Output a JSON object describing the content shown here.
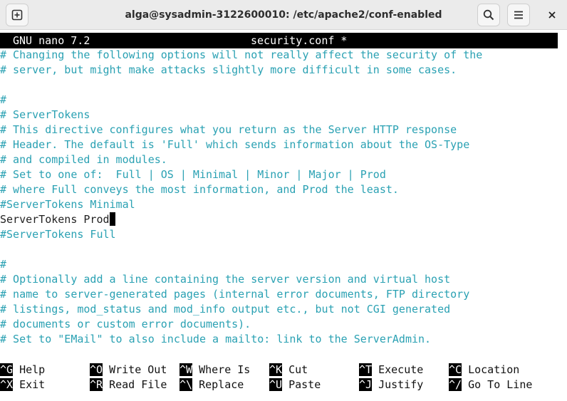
{
  "window": {
    "title": "alga@sysadmin-3122600010: /etc/apache2/conf-enabled"
  },
  "titlebar_icons": {
    "new_tab": "new-tab-icon",
    "search": "search-icon",
    "menu": "hamburger-menu-icon",
    "close": "close-icon"
  },
  "nano": {
    "version": "GNU nano 7.2",
    "filename": "security.conf *"
  },
  "file_lines": [
    "# Changing the following options will not really affect the security of the",
    "# server, but might make attacks slightly more difficult in some cases.",
    "",
    "#",
    "# ServerTokens",
    "# This directive configures what you return as the Server HTTP response",
    "# Header. The default is 'Full' which sends information about the OS-Type",
    "# and compiled in modules.",
    "# Set to one of:  Full | OS | Minimal | Minor | Major | Prod",
    "# where Full conveys the most information, and Prod the least.",
    "#ServerTokens Minimal",
    "ServerTokens Prod",
    "#ServerTokens Full",
    "",
    "#",
    "# Optionally add a line containing the server version and virtual host",
    "# name to server-generated pages (internal error documents, FTP directory",
    "# listings, mod_status and mod_info output etc., but not CGI generated",
    "# documents or custom error documents).",
    "# Set to \"EMail\" to also include a mailto: link to the ServerAdmin."
  ],
  "shortcuts_row1": [
    {
      "key": "^G",
      "label": "Help"
    },
    {
      "key": "^O",
      "label": "Write Out"
    },
    {
      "key": "^W",
      "label": "Where Is"
    },
    {
      "key": "^K",
      "label": "Cut"
    },
    {
      "key": "^T",
      "label": "Execute"
    },
    {
      "key": "^C",
      "label": "Location"
    }
  ],
  "shortcuts_row2": [
    {
      "key": "^X",
      "label": "Exit"
    },
    {
      "key": "^R",
      "label": "Read File"
    },
    {
      "key": "^\\",
      "label": "Replace"
    },
    {
      "key": "^U",
      "label": "Paste"
    },
    {
      "key": "^J",
      "label": "Justify"
    },
    {
      "key": "^/",
      "label": "Go To Line"
    }
  ],
  "colors": {
    "comment": "#2aa1b3",
    "text": "#222222",
    "statusbar_bg": "#000000",
    "statusbar_fg": "#ffffff"
  }
}
